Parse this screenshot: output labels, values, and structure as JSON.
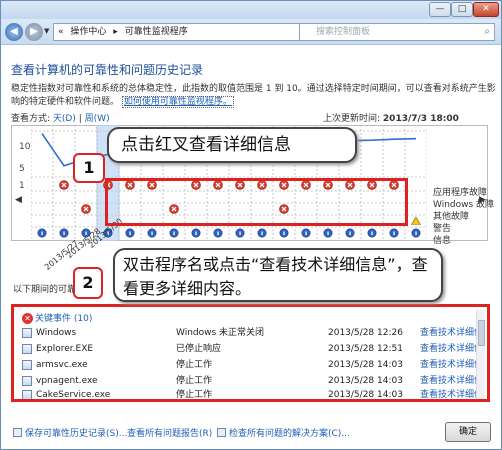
{
  "window": {
    "minimize_glyph": "—",
    "maximize_glyph": "□",
    "close_glyph": "✕"
  },
  "nav": {
    "back_glyph": "◀",
    "forward_glyph": "▶",
    "breadcrumb": [
      "«",
      "操作中心",
      "▸",
      "可靠性监视程序"
    ],
    "search_placeholder": "搜索控制面板"
  },
  "page": {
    "title": "查看计算机的可靠性和问题历史记录",
    "description": "稳定性指数对可靠性和系统的总体稳定性，此指数的取值范围是 1 到 10。通过选择特定时间期间，可以查看对系统产生影响的特定硬件和软件问题。",
    "desc_link": "如何使用可靠性监视程序。",
    "view_by_label": "查看方式:",
    "view_day": "天(D)",
    "view_sep": "|",
    "view_week": "周(W)",
    "last_updated_label": "上次更新时间:",
    "last_updated_value": "2013/7/3 18:00"
  },
  "chart_data": {
    "type": "line",
    "y_ticks": [
      "10",
      "5",
      "1"
    ],
    "ylim": [
      1,
      10
    ],
    "categories_rows": [
      "应用程序故障",
      "Windows 故障",
      "其他故障",
      "警告",
      "信息"
    ],
    "x_dates": [
      "2013/5/27",
      "2013/5/28",
      "2013/5/30"
    ],
    "stability_index": [
      9.5,
      3.2,
      4.6,
      5.4,
      5.7,
      6.1,
      6.4,
      6.7,
      7.0,
      7.2,
      7.4,
      7.6,
      7.8,
      8.0,
      8.1,
      8.2,
      8.4,
      8.5
    ],
    "app_failures": [
      0,
      1,
      0,
      1,
      1,
      1,
      0,
      1,
      1,
      1,
      1,
      1,
      1,
      1,
      1,
      1,
      1,
      0
    ],
    "other_failures": [
      0,
      0,
      1,
      0,
      0,
      0,
      1,
      0,
      0,
      0,
      0,
      1,
      0,
      0,
      0,
      0,
      0,
      0
    ],
    "warnings": [
      0,
      0,
      0,
      0,
      0,
      0,
      0,
      0,
      0,
      0,
      0,
      0,
      0,
      0,
      0,
      0,
      0,
      1
    ],
    "info": [
      1,
      1,
      1,
      1,
      1,
      1,
      1,
      1,
      1,
      1,
      1,
      1,
      1,
      1,
      1,
      1,
      1,
      1
    ],
    "selected_column": 3
  },
  "annotations": {
    "note1_number": "1",
    "note1_text": "点击红叉查看详细信息",
    "note2_number": "2",
    "note2_text": "双击程序名或点击“查看技术详细信息”，查看更多详细内容。"
  },
  "events": {
    "below_label": "以下期间的可靠",
    "group_label": "关键事件 (10)",
    "rows": [
      {
        "name": "Windows",
        "status": "Windows 未正常关闭",
        "date": "2013/5/28 12:26",
        "action": "查看技术详细信"
      },
      {
        "name": "Explorer.EXE",
        "status": "已停止响应",
        "date": "2013/5/28 12:51",
        "action": "查看技术详细信"
      },
      {
        "name": "armsvc.exe",
        "status": "停止工作",
        "date": "2013/5/28 14:03",
        "action": "查看技术详细信"
      },
      {
        "name": "vpnagent.exe",
        "status": "停止工作",
        "date": "2013/5/28 14:03",
        "action": "查看技术详细信"
      },
      {
        "name": "CakeService.exe",
        "status": "停止工作",
        "date": "2013/5/28 14:03",
        "action": "查看技术详细信"
      }
    ]
  },
  "footer": {
    "save_link": "保存可靠性历史记录(S)...",
    "reports_link": "查看所有问题报告(R)",
    "solutions_link": "检查所有问题的解决方案(C)...",
    "ok_label": "确定"
  }
}
